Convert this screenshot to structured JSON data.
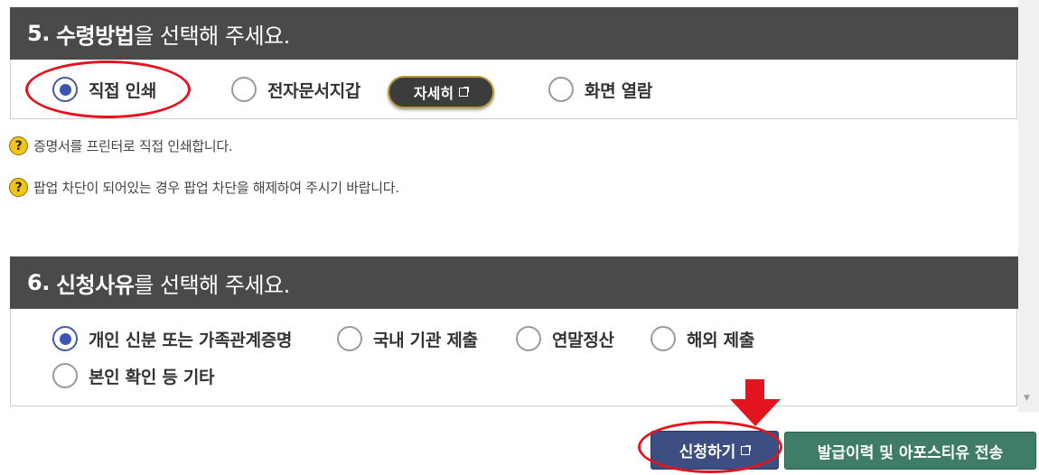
{
  "section5": {
    "number": "5.",
    "title_bold": "수령방법",
    "title_rest": "을 선택해 주세요.",
    "options": [
      {
        "label": "직접 인쇄",
        "checked": true
      },
      {
        "label": "전자문서지갑",
        "checked": false
      },
      {
        "label": "화면 열람",
        "checked": false
      }
    ],
    "detail_button": "자세히"
  },
  "help": [
    {
      "icon": "?",
      "text": "증명서를 프린터로 직접 인쇄합니다."
    },
    {
      "icon": "?",
      "text": "팝업 차단이 되어있는 경우 팝업 차단을 해제하여 주시기 바랍니다."
    }
  ],
  "section6": {
    "number": "6.",
    "title_bold": "신청사유",
    "title_rest": "를 선택해 주세요.",
    "options": [
      {
        "label": "개인 신분 또는 가족관계증명",
        "checked": true
      },
      {
        "label": "국내 기관 제출",
        "checked": false
      },
      {
        "label": "연말정산",
        "checked": false
      },
      {
        "label": "해외 제출",
        "checked": false
      },
      {
        "label": "본인 확인 등 기타",
        "checked": false
      }
    ]
  },
  "buttons": {
    "apply": "신청하기",
    "history": "발급이력 및 아포스티유 전송"
  },
  "colors": {
    "header_bg": "#4a4a4a",
    "apply_bg": "#3d4f82",
    "history_bg": "#3f7d68",
    "annotation_red": "#e2151f"
  }
}
